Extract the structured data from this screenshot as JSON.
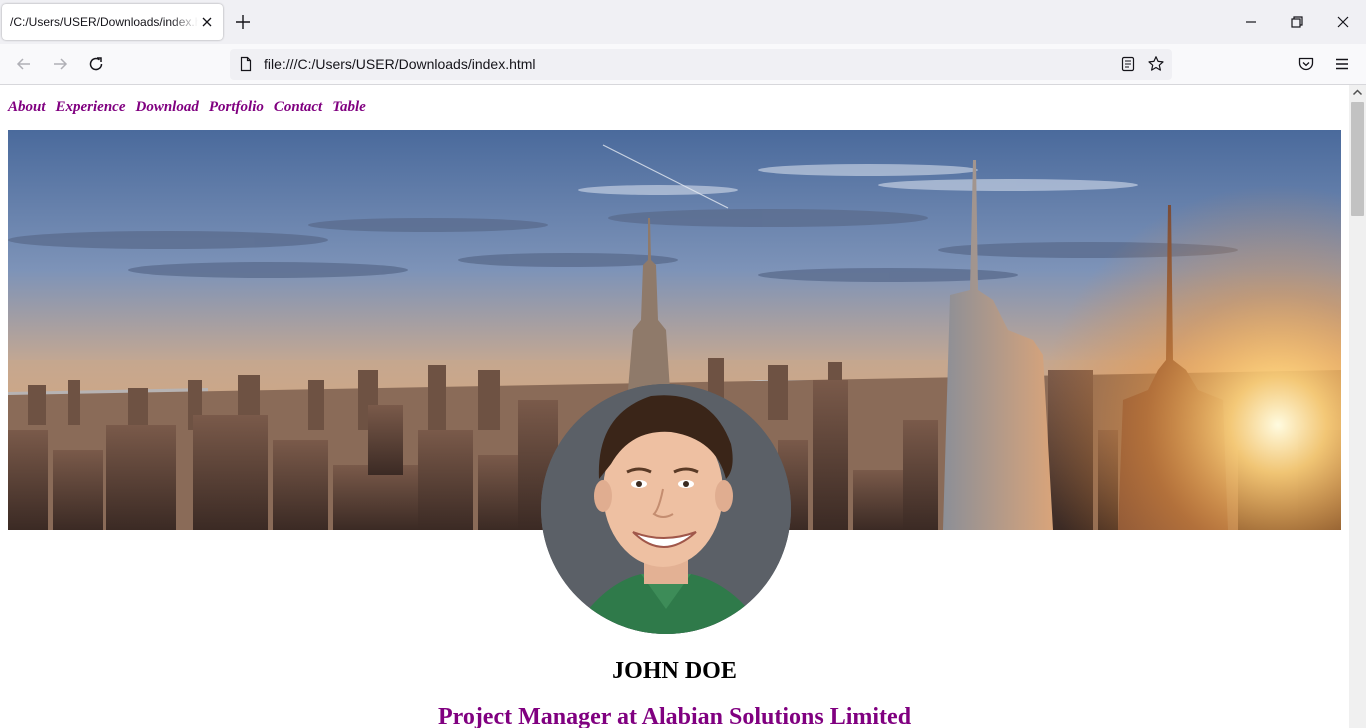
{
  "browser": {
    "tab_title": "/C:/Users/USER/Downloads/index.html",
    "url": "file:///C:/Users/USER/Downloads/index.html"
  },
  "site": {
    "nav": [
      "About",
      "Experience",
      "Download",
      "Portfolio",
      "Contact",
      "Table"
    ],
    "name": "JOHN DOE",
    "role": "Project Manager at Alabian Solutions Limited"
  },
  "colors": {
    "nav_link": "#800080",
    "role_text": "#800080",
    "chrome_bg": "#f0f0f4"
  }
}
